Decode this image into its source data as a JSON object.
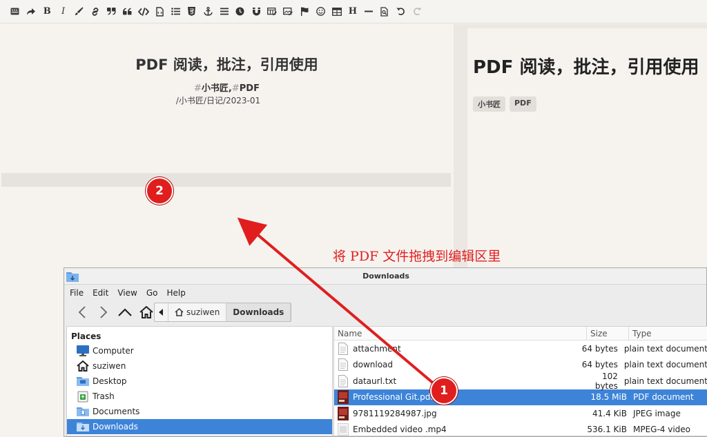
{
  "toolbar": {
    "buttons": [
      "sidebar-icon",
      "redo-share-icon",
      "bold-icon",
      "italic-icon",
      "brush-icon",
      "link-icon",
      "quote-icon",
      "blockquote-icon",
      "code-icon",
      "file-code-icon",
      "list-icon",
      "html5-icon",
      "anchor-icon",
      "align-icon",
      "clock-icon",
      "magnet-icon",
      "table-edit-icon",
      "image-edit-icon",
      "flag-icon",
      "emoji-icon",
      "table-icon",
      "heading-icon",
      "hr-icon",
      "search-file-icon",
      "undo-icon",
      "redo-icon"
    ],
    "bold_label": "B",
    "italic_label": "I",
    "heading_label": "H"
  },
  "editor": {
    "title": "PDF 阅读，批注，引用使用",
    "tag_hash": "#",
    "tag1": "小书匠",
    "tag_sep": ",",
    "tag2": "PDF",
    "path": "/小书匠/日记/2023-01"
  },
  "preview": {
    "title": "PDF 阅读，批注，引用使用",
    "tags": [
      "小书匠",
      "PDF"
    ]
  },
  "annotation": {
    "text": "将 PDF 文件拖拽到编辑区里",
    "badge1": "1",
    "badge2": "2",
    "color": "#e01e1e"
  },
  "file_manager": {
    "title": "Downloads",
    "menu": [
      "File",
      "Edit",
      "View",
      "Go",
      "Help"
    ],
    "breadcrumbs": [
      "suziwen",
      "Downloads"
    ],
    "places_header": "Places",
    "places": [
      {
        "label": "Computer",
        "icon": "computer-icon"
      },
      {
        "label": "suziwen",
        "icon": "home-icon"
      },
      {
        "label": "Desktop",
        "icon": "desktop-folder-icon"
      },
      {
        "label": "Trash",
        "icon": "trash-icon"
      },
      {
        "label": "Documents",
        "icon": "documents-folder-icon"
      },
      {
        "label": "Downloads",
        "icon": "downloads-folder-icon",
        "selected": true
      }
    ],
    "columns": {
      "name": "Name",
      "size": "Size",
      "type": "Type"
    },
    "files": [
      {
        "name": "attachment",
        "size": "64 bytes",
        "type": "plain text document",
        "icon": "text-file-icon"
      },
      {
        "name": "download",
        "size": "64 bytes",
        "type": "plain text document",
        "icon": "text-file-icon"
      },
      {
        "name": "dataurl.txt",
        "size": "102 bytes",
        "type": "plain text document",
        "icon": "text-file-icon"
      },
      {
        "name": "Professional Git.pdf",
        "size": "18.5 MiB",
        "type": "PDF document",
        "icon": "pdf-thumbnail-icon",
        "selected": true
      },
      {
        "name": "9781119284987.jpg",
        "size": "41.4 KiB",
        "type": "JPEG image",
        "icon": "jpg-thumbnail-icon"
      },
      {
        "name": "Embedded video .mp4",
        "size": "536.1 KiB",
        "type": "MPEG-4 video",
        "icon": "video-file-icon"
      }
    ],
    "accent": "#3d84d9"
  }
}
